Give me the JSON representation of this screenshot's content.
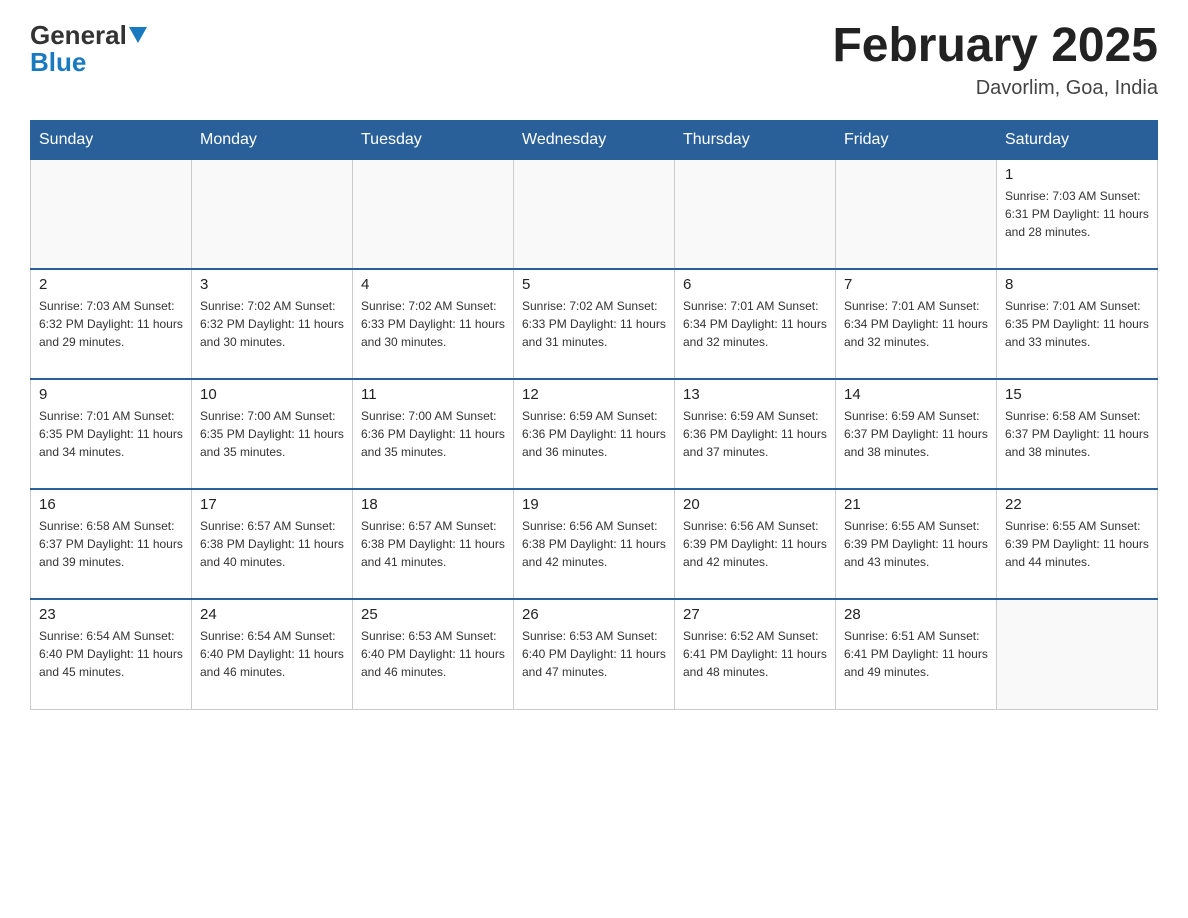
{
  "header": {
    "logo_general": "General",
    "logo_blue": "Blue",
    "title": "February 2025",
    "location": "Davorlim, Goa, India"
  },
  "days_of_week": [
    "Sunday",
    "Monday",
    "Tuesday",
    "Wednesday",
    "Thursday",
    "Friday",
    "Saturday"
  ],
  "weeks": [
    [
      {
        "day": "",
        "info": ""
      },
      {
        "day": "",
        "info": ""
      },
      {
        "day": "",
        "info": ""
      },
      {
        "day": "",
        "info": ""
      },
      {
        "day": "",
        "info": ""
      },
      {
        "day": "",
        "info": ""
      },
      {
        "day": "1",
        "info": "Sunrise: 7:03 AM\nSunset: 6:31 PM\nDaylight: 11 hours and 28 minutes."
      }
    ],
    [
      {
        "day": "2",
        "info": "Sunrise: 7:03 AM\nSunset: 6:32 PM\nDaylight: 11 hours and 29 minutes."
      },
      {
        "day": "3",
        "info": "Sunrise: 7:02 AM\nSunset: 6:32 PM\nDaylight: 11 hours and 30 minutes."
      },
      {
        "day": "4",
        "info": "Sunrise: 7:02 AM\nSunset: 6:33 PM\nDaylight: 11 hours and 30 minutes."
      },
      {
        "day": "5",
        "info": "Sunrise: 7:02 AM\nSunset: 6:33 PM\nDaylight: 11 hours and 31 minutes."
      },
      {
        "day": "6",
        "info": "Sunrise: 7:01 AM\nSunset: 6:34 PM\nDaylight: 11 hours and 32 minutes."
      },
      {
        "day": "7",
        "info": "Sunrise: 7:01 AM\nSunset: 6:34 PM\nDaylight: 11 hours and 32 minutes."
      },
      {
        "day": "8",
        "info": "Sunrise: 7:01 AM\nSunset: 6:35 PM\nDaylight: 11 hours and 33 minutes."
      }
    ],
    [
      {
        "day": "9",
        "info": "Sunrise: 7:01 AM\nSunset: 6:35 PM\nDaylight: 11 hours and 34 minutes."
      },
      {
        "day": "10",
        "info": "Sunrise: 7:00 AM\nSunset: 6:35 PM\nDaylight: 11 hours and 35 minutes."
      },
      {
        "day": "11",
        "info": "Sunrise: 7:00 AM\nSunset: 6:36 PM\nDaylight: 11 hours and 35 minutes."
      },
      {
        "day": "12",
        "info": "Sunrise: 6:59 AM\nSunset: 6:36 PM\nDaylight: 11 hours and 36 minutes."
      },
      {
        "day": "13",
        "info": "Sunrise: 6:59 AM\nSunset: 6:36 PM\nDaylight: 11 hours and 37 minutes."
      },
      {
        "day": "14",
        "info": "Sunrise: 6:59 AM\nSunset: 6:37 PM\nDaylight: 11 hours and 38 minutes."
      },
      {
        "day": "15",
        "info": "Sunrise: 6:58 AM\nSunset: 6:37 PM\nDaylight: 11 hours and 38 minutes."
      }
    ],
    [
      {
        "day": "16",
        "info": "Sunrise: 6:58 AM\nSunset: 6:37 PM\nDaylight: 11 hours and 39 minutes."
      },
      {
        "day": "17",
        "info": "Sunrise: 6:57 AM\nSunset: 6:38 PM\nDaylight: 11 hours and 40 minutes."
      },
      {
        "day": "18",
        "info": "Sunrise: 6:57 AM\nSunset: 6:38 PM\nDaylight: 11 hours and 41 minutes."
      },
      {
        "day": "19",
        "info": "Sunrise: 6:56 AM\nSunset: 6:38 PM\nDaylight: 11 hours and 42 minutes."
      },
      {
        "day": "20",
        "info": "Sunrise: 6:56 AM\nSunset: 6:39 PM\nDaylight: 11 hours and 42 minutes."
      },
      {
        "day": "21",
        "info": "Sunrise: 6:55 AM\nSunset: 6:39 PM\nDaylight: 11 hours and 43 minutes."
      },
      {
        "day": "22",
        "info": "Sunrise: 6:55 AM\nSunset: 6:39 PM\nDaylight: 11 hours and 44 minutes."
      }
    ],
    [
      {
        "day": "23",
        "info": "Sunrise: 6:54 AM\nSunset: 6:40 PM\nDaylight: 11 hours and 45 minutes."
      },
      {
        "day": "24",
        "info": "Sunrise: 6:54 AM\nSunset: 6:40 PM\nDaylight: 11 hours and 46 minutes."
      },
      {
        "day": "25",
        "info": "Sunrise: 6:53 AM\nSunset: 6:40 PM\nDaylight: 11 hours and 46 minutes."
      },
      {
        "day": "26",
        "info": "Sunrise: 6:53 AM\nSunset: 6:40 PM\nDaylight: 11 hours and 47 minutes."
      },
      {
        "day": "27",
        "info": "Sunrise: 6:52 AM\nSunset: 6:41 PM\nDaylight: 11 hours and 48 minutes."
      },
      {
        "day": "28",
        "info": "Sunrise: 6:51 AM\nSunset: 6:41 PM\nDaylight: 11 hours and 49 minutes."
      },
      {
        "day": "",
        "info": ""
      }
    ]
  ]
}
